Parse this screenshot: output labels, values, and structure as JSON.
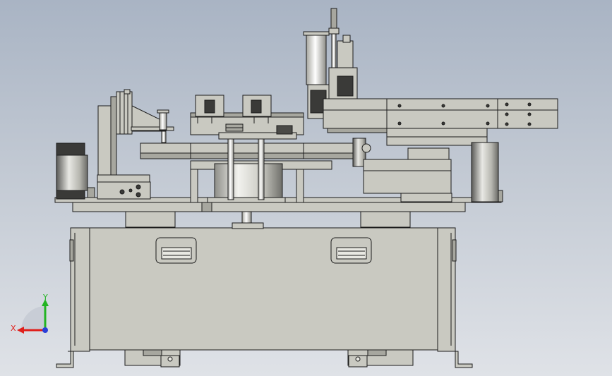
{
  "view": {
    "background_top": "#a9b4c4",
    "background_bottom": "#dfe2e7",
    "part_fill": "#c9c9c1",
    "part_fill_dark": "#a7a79f",
    "edge_color": "#1c1c1c"
  },
  "triad": {
    "x_label": "X",
    "y_label": "Y",
    "x_color": "#e0201c",
    "y_color": "#22b422",
    "z_color": "#2a3fd8"
  }
}
